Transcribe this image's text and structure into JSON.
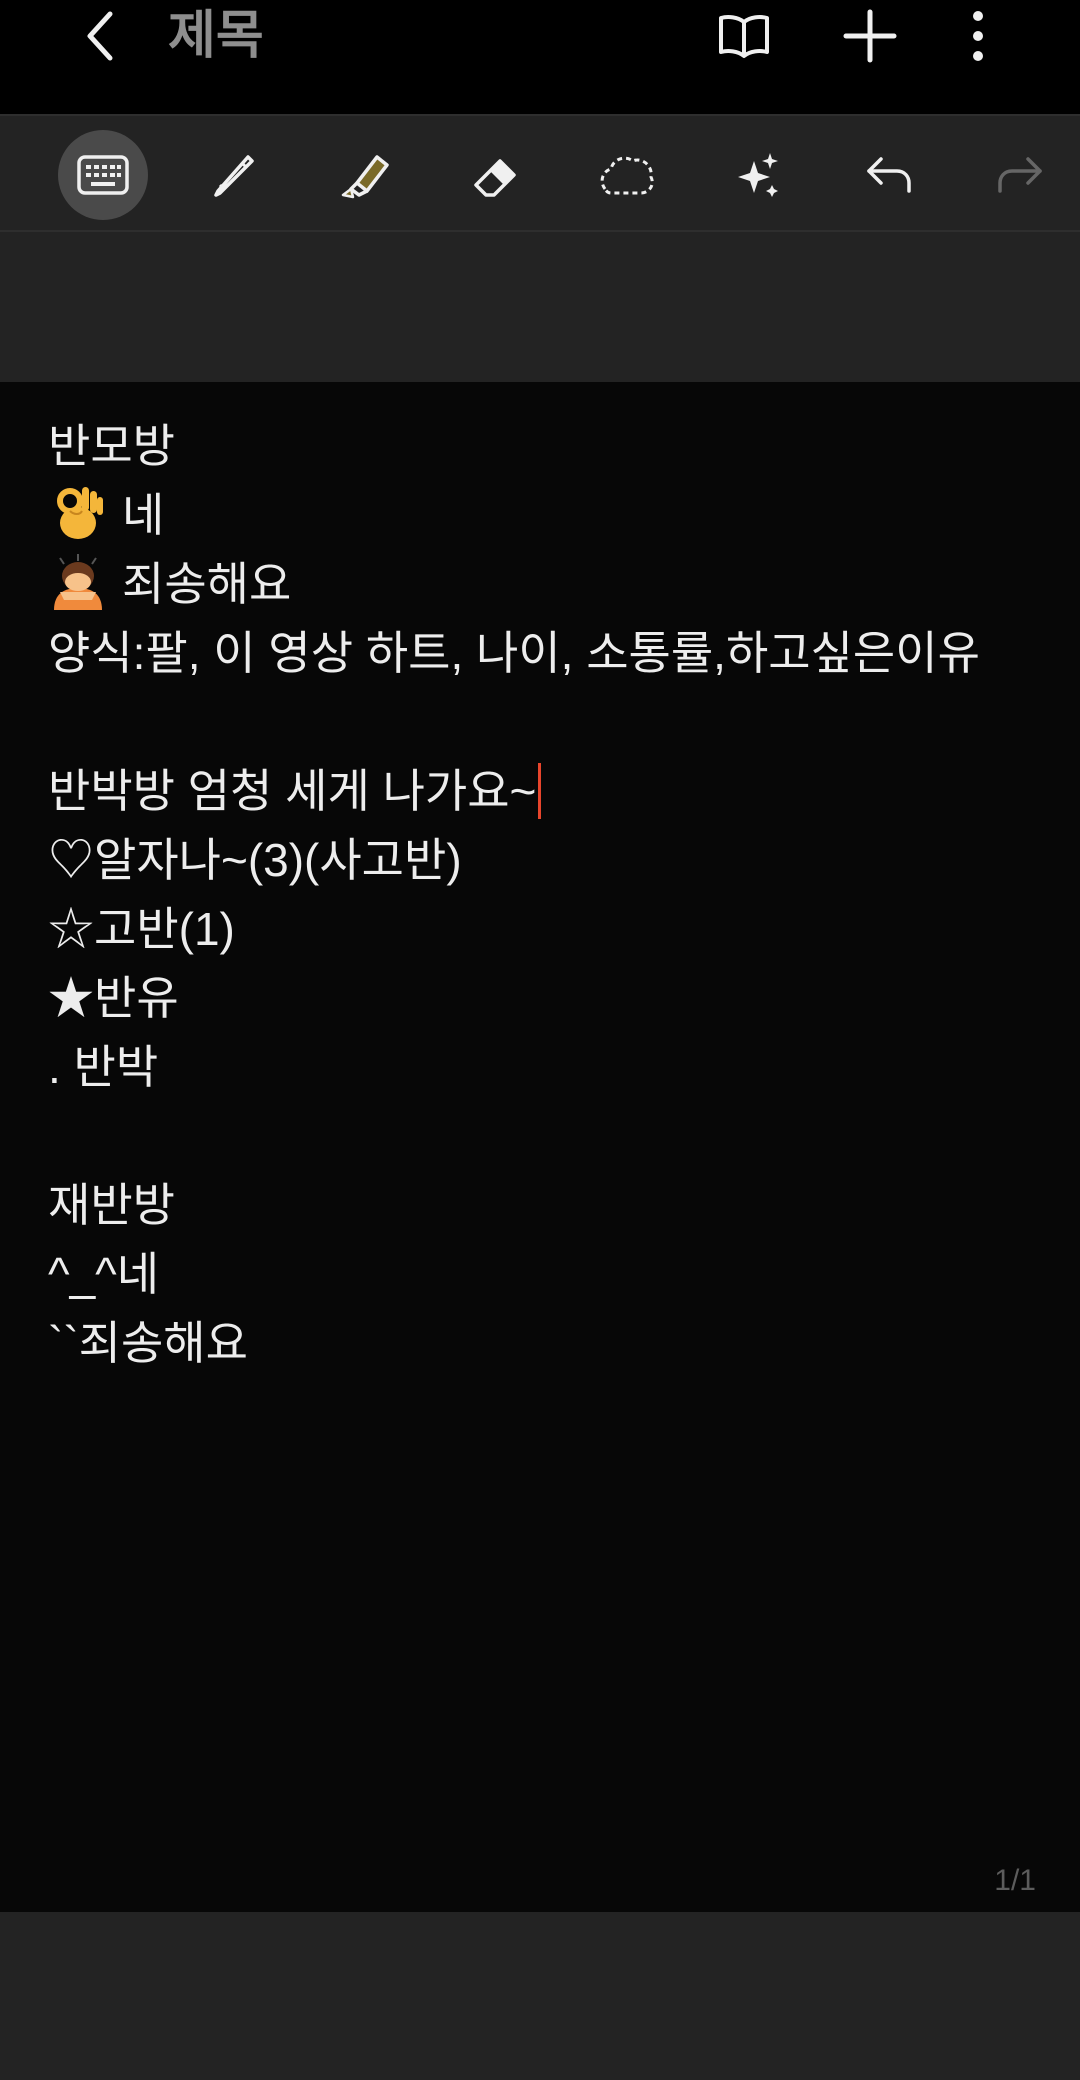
{
  "header": {
    "title": "제목",
    "back_icon": "chevron-left-icon",
    "actions": [
      {
        "name": "book-view-icon"
      },
      {
        "name": "add-icon"
      },
      {
        "name": "more-vertical-icon"
      }
    ]
  },
  "toolbar": {
    "tools": [
      {
        "name": "keyboard-icon",
        "active": true
      },
      {
        "name": "pen-icon"
      },
      {
        "name": "highlighter-icon"
      },
      {
        "name": "eraser-icon"
      },
      {
        "name": "lasso-select-icon"
      },
      {
        "name": "ai-sparkle-icon"
      },
      {
        "name": "undo-icon"
      },
      {
        "name": "redo-icon",
        "disabled": true
      }
    ]
  },
  "note": {
    "lines": [
      "반모방",
      "네",
      "죄송해요",
      "양식:팔, 이 영상 하트, 나이, 소통률,하고싶은이유",
      "",
      "반박방 엄청 세게 나가요~",
      "♡알자나~(3)(사고반)",
      "☆고반(1)",
      "★반유",
      ". 반박",
      "",
      "재반방",
      "^_^네",
      "``죄송해요"
    ],
    "emojis": {
      "1": "ok-hand-emoji",
      "2": "person-bowing-emoji"
    }
  },
  "page_indicator": "1/1",
  "colors": {
    "background": "#000000",
    "toolbar": "#232323",
    "text": "#ededed",
    "cursor": "#e8452c",
    "title": "#8e8e8e"
  }
}
